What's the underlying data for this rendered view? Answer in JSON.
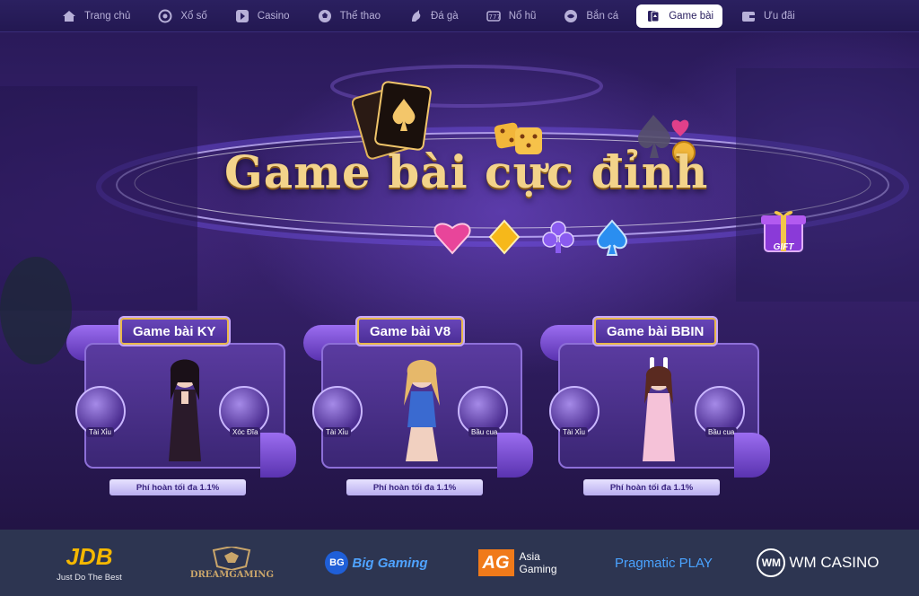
{
  "nav": {
    "items": [
      {
        "label": "Trang chủ",
        "icon": "home-icon"
      },
      {
        "label": "Xổ số",
        "icon": "lottery-ball-icon"
      },
      {
        "label": "Casino",
        "icon": "play-icon"
      },
      {
        "label": "Thể thao",
        "icon": "soccer-ball-icon"
      },
      {
        "label": "Đá gà",
        "icon": "rooster-icon"
      },
      {
        "label": "Nổ hũ",
        "icon": "slot-machine-icon"
      },
      {
        "label": "Bắn cá",
        "icon": "fish-icon"
      },
      {
        "label": "Game bài",
        "icon": "cards-icon",
        "active": true
      },
      {
        "label": "Ưu đãi",
        "icon": "wallet-icon"
      }
    ]
  },
  "hero": {
    "title": "Game bài cực đỉnh",
    "gift_label": "GIFT"
  },
  "cards": [
    {
      "title": "Game bài KY",
      "left_label": "Tài Xỉu",
      "right_label": "Xóc Đĩa",
      "footer": "Phí hoàn tối đa 1.1%"
    },
    {
      "title": "Game bài V8",
      "left_label": "Tài Xỉu",
      "right_label": "Bầu cua",
      "footer": "Phí hoàn tối đa 1.1%"
    },
    {
      "title": "Game bài BBIN",
      "left_label": "Tài Xỉu",
      "right_label": "Bầu cua",
      "footer": "Phí hoàn tối đa 1.1%"
    }
  ],
  "providers": [
    {
      "name": "JDB",
      "sub": "Just Do The Best",
      "color": "#f5b800"
    },
    {
      "name": "DREAMGAMING",
      "sub": "",
      "color": "#c9a56a"
    },
    {
      "name": "Big Gaming",
      "sub": "",
      "color": "#4fa3ff"
    },
    {
      "name": "Asia Gaming",
      "sub": "",
      "color": "#f07a1a"
    },
    {
      "name": "Pragmatic PLAY",
      "sub": "",
      "color": "#4aa3ff"
    },
    {
      "name": "WM CASINO",
      "sub": "",
      "color": "#ffffff"
    }
  ],
  "colors": {
    "nav_bg": "#2b2060",
    "accent_gold": "#f3d38a",
    "card_purple": "#5a3ba0",
    "footer_bg": "#2d3551"
  }
}
